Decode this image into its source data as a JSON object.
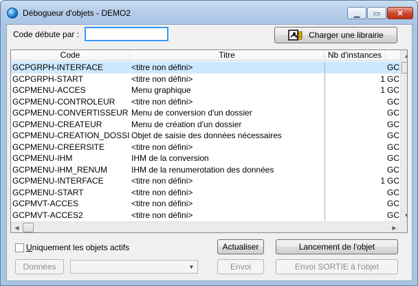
{
  "window": {
    "title": "Débogueur d'objets - DEMO2",
    "min_glyph": "▁",
    "max_glyph": "▭",
    "close_glyph": "✕"
  },
  "filter": {
    "label": "Code débute par :",
    "value": "",
    "load_library_label": "Charger une librairie"
  },
  "grid": {
    "columns": [
      "Code",
      "Titre",
      "Nb d'instances",
      ""
    ],
    "rows": [
      {
        "code": "GCPGRPH-INTERFACE",
        "titre": "<titre non défini>",
        "nb": "",
        "extra": "GC",
        "selected": true
      },
      {
        "code": "GCPGRPH-START",
        "titre": "<titre non défini>",
        "nb": "1",
        "extra": "GC",
        "selected": false
      },
      {
        "code": "GCPMENU-ACCES",
        "titre": "Menu graphique",
        "nb": "1",
        "extra": "GC",
        "selected": false
      },
      {
        "code": "GCPMENU-CONTROLEUR",
        "titre": "<titre non défini>",
        "nb": "",
        "extra": "GC",
        "selected": false
      },
      {
        "code": "GCPMENU-CONVERTISSEUR",
        "titre": "Menu de conversion d'un dossier",
        "nb": "",
        "extra": "GC",
        "selected": false
      },
      {
        "code": "GCPMENU-CREATEUR",
        "titre": "Menu de création d'un dossier",
        "nb": "",
        "extra": "GC",
        "selected": false
      },
      {
        "code": "GCPMENU-CREATION_DOSSI",
        "titre": "Objet de saisie des données nécessaires",
        "nb": "",
        "extra": "GC",
        "selected": false
      },
      {
        "code": "GCPMENU-CREERSITE",
        "titre": "<titre non défini>",
        "nb": "",
        "extra": "GC",
        "selected": false
      },
      {
        "code": "GCPMENU-IHM",
        "titre": "IHM de la conversion",
        "nb": "",
        "extra": "GC",
        "selected": false
      },
      {
        "code": "GCPMENU-IHM_RENUM",
        "titre": "IHM de la renumerotation des données",
        "nb": "",
        "extra": "GC",
        "selected": false
      },
      {
        "code": "GCPMENU-INTERFACE",
        "titre": "<titre non défini>",
        "nb": "1",
        "extra": "GC",
        "selected": false
      },
      {
        "code": "GCPMENU-START",
        "titre": "<titre non défini>",
        "nb": "",
        "extra": "GC",
        "selected": false
      },
      {
        "code": "GCPMVT-ACCES",
        "titre": "<titre non défini>",
        "nb": "",
        "extra": "GC",
        "selected": false
      },
      {
        "code": "GCPMVT-ACCES2",
        "titre": "<titre non défini>",
        "nb": "",
        "extra": "GC",
        "selected": false
      }
    ]
  },
  "options": {
    "active_only_label": "Uniquement les objets actifs",
    "active_only_checked": false
  },
  "buttons": {
    "refresh": "Actualiser",
    "launch": "Lancement  de l'objet",
    "data": "Données",
    "send": "Envoi",
    "send_output": "Envoi SORTIE à l'objet"
  },
  "combo": {
    "value": ""
  },
  "icons": {
    "up": "▲",
    "down": "▼",
    "left": "◀",
    "right": "▶",
    "dropdown": "▼"
  },
  "colors": {
    "selection": "#cce8ff",
    "focus_border": "#3399ff",
    "close_button": "#c9452d"
  }
}
